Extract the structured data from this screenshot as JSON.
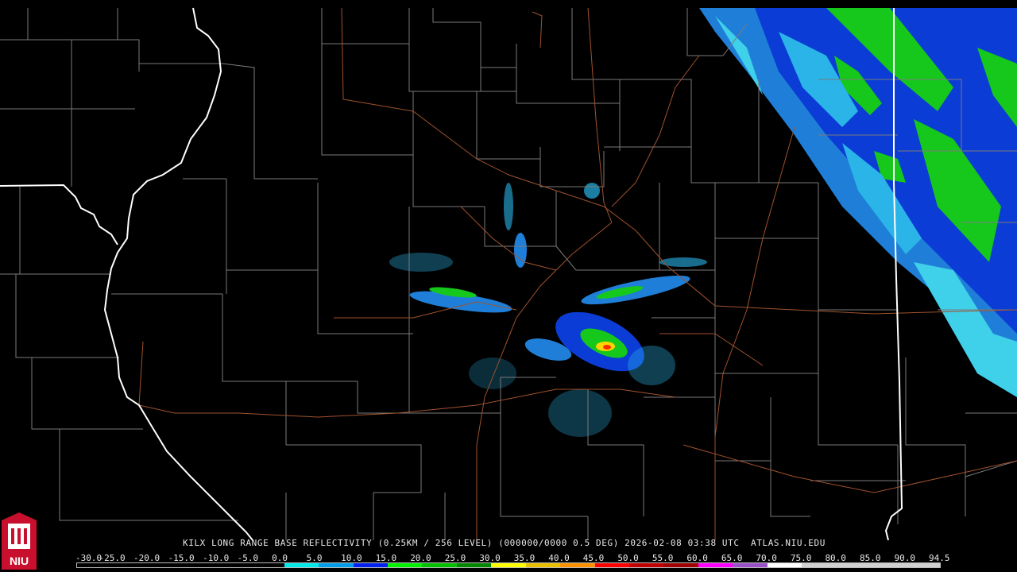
{
  "caption": "KILX LONG RANGE BASE REFLECTIVITY (0.25KM / 256 LEVEL) (000000/0000 0.5 DEG) 2026-02-08 03:38 UTC  ATLAS.NIU.EDU",
  "logo_text": "NIU",
  "colors": {
    "background": "#000000",
    "county_lines": "#7a7a7a",
    "state_lines": "#ffffff",
    "roads": "#a0522d",
    "logo": "#c8102e"
  },
  "legend": {
    "labels": [
      "-30.0",
      "-25.0",
      "-20.0",
      "-15.0",
      "-10.0",
      "-5.0",
      "0.0",
      "5.0",
      "10.0",
      "15.0",
      "20.0",
      "25.0",
      "30.0",
      "35.0",
      "40.0",
      "45.0",
      "50.0",
      "55.0",
      "60.0",
      "65.0",
      "70.0",
      "75.0",
      "80.0",
      "85.0",
      "90.0",
      "94.5"
    ],
    "colors": [
      "#000000",
      "#000000",
      "#000000",
      "#000000",
      "#000000",
      "#000000",
      "#00e8e8",
      "#009ee8",
      "#0020f0",
      "#00f000",
      "#00c000",
      "#008800",
      "#ffff00",
      "#e8c000",
      "#ff9000",
      "#ff0000",
      "#c00000",
      "#a00000",
      "#ff00ff",
      "#9a50c8",
      "#ffffff",
      "#d0d0d0",
      "#d0d0d0",
      "#d0d0d0",
      "#d0d0d0"
    ]
  }
}
